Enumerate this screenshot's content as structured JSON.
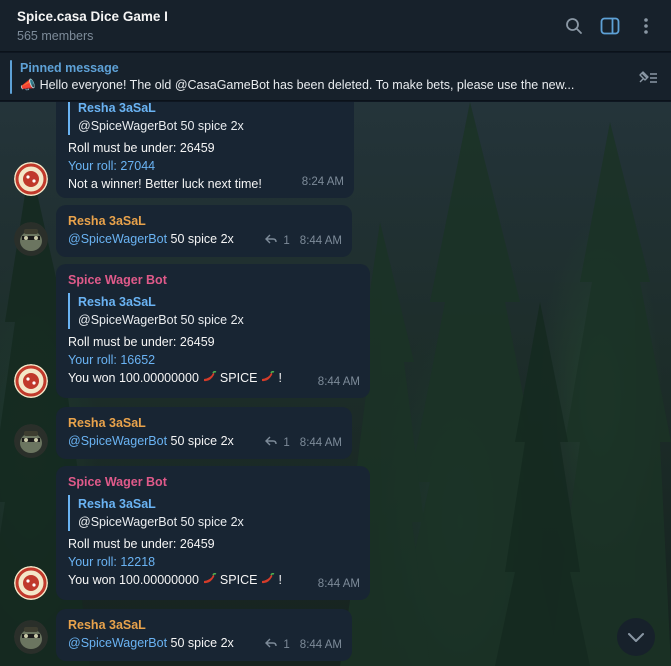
{
  "header": {
    "title": "Spice.casa Dice Game I",
    "members": "565 members",
    "icons": [
      "search-icon",
      "sidebar-toggle-icon",
      "more-vert-icon"
    ]
  },
  "pinned": {
    "label": "Pinned message",
    "emoji": "📣",
    "text": "Hello everyone! The old @CasaGameBot has been deleted. To make bets, please use the new...",
    "action_icon": "unpin-list-icon"
  },
  "messages": [
    {
      "type": "bot",
      "quote_name": "Resha 3aSaL",
      "quote_text": "@SpiceWagerBot 50 spice 2x",
      "line1": "Roll must be under: 26459",
      "line2": "Your roll: 27044",
      "line3": "Not a winner! Better luck next time!",
      "time": "8:24 AM"
    },
    {
      "type": "user",
      "sender": "Resha 3aSaL",
      "mention": "@SpiceWagerBot",
      "text": " 50 spice 2x",
      "replies": "1",
      "time": "8:44 AM"
    },
    {
      "type": "bot",
      "sender": "Spice Wager Bot",
      "quote_name": "Resha 3aSaL",
      "quote_text": "@SpiceWagerBot 50 spice 2x",
      "line1": "Roll must be under: 26459",
      "line2": "Your roll: 16652",
      "line3a": "You won 100.00000000",
      "line3b": "SPICE",
      "line3c": "!",
      "time": "8:44 AM"
    },
    {
      "type": "user",
      "sender": "Resha 3aSaL",
      "mention": "@SpiceWagerBot",
      "text": " 50 spice 2x",
      "replies": "1",
      "time": "8:44 AM"
    },
    {
      "type": "bot",
      "sender": "Spice Wager Bot",
      "quote_name": "Resha 3aSaL",
      "quote_text": "@SpiceWagerBot 50 spice 2x",
      "line1": "Roll must be under: 26459",
      "line2": "Your roll: 12218",
      "line3a": "You won 100.00000000",
      "line3b": "SPICE",
      "line3c": "!",
      "time": "8:44 AM"
    },
    {
      "type": "user",
      "sender": "Resha 3aSaL",
      "mention": "@SpiceWagerBot",
      "text": " 50 spice 2x",
      "replies": "1",
      "time": "8:44 AM"
    }
  ],
  "colors": {
    "header_bg": "#17212b",
    "bubble_bg": "#182533",
    "accent": "#6ab3f3",
    "bot_name": "#e05a8a",
    "user_name": "#e8a24b"
  }
}
